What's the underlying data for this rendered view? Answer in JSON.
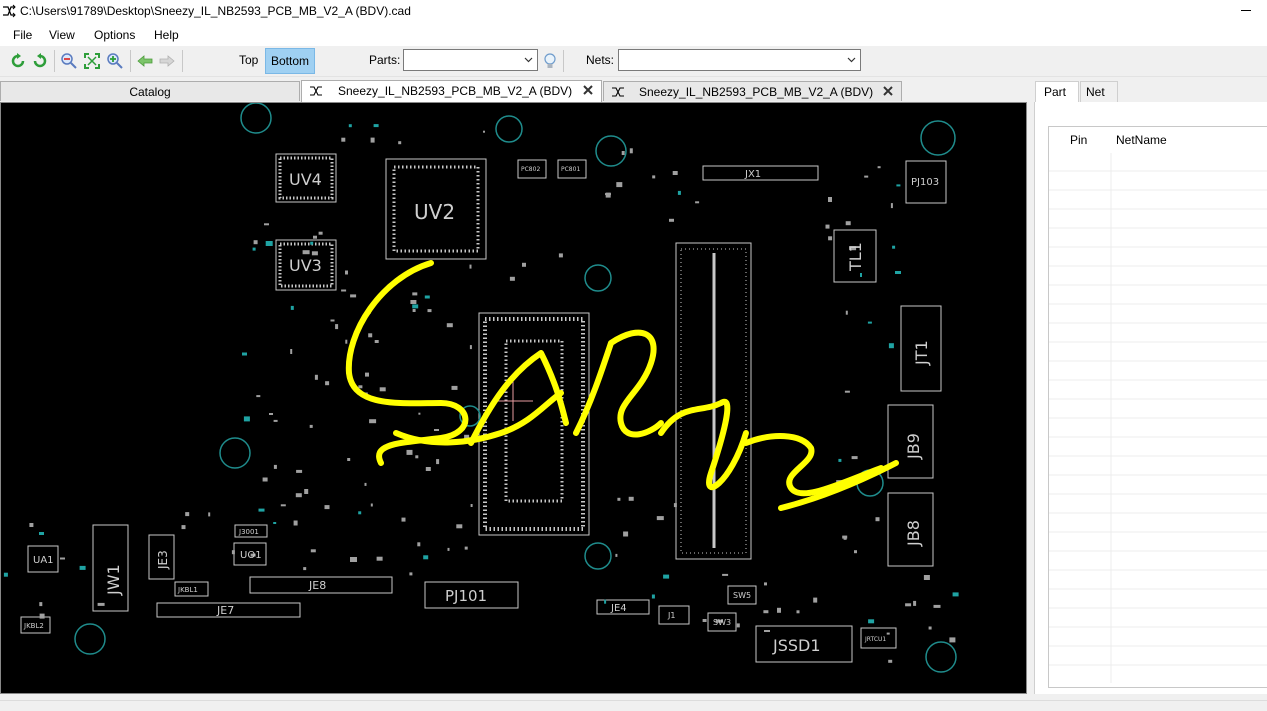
{
  "window": {
    "title": "C:\\Users\\91789\\Desktop\\Sneezy_IL_NB2593_PCB_MB_V2_A (BDV).cad"
  },
  "menu": [
    "File",
    "View",
    "Options",
    "Help"
  ],
  "toolbar": {
    "icons": [
      "refresh-green-icon",
      "refresh-green-alt-icon",
      "zoom-out-icon",
      "fit-view-icon",
      "zoom-in-icon",
      "back-arrow-icon",
      "forward-arrow-icon"
    ],
    "side_top": "Top",
    "side_bottom": "Bottom",
    "side_selected": "Bottom",
    "parts_label": "Parts:",
    "parts_value": "",
    "nets_label": "Nets:",
    "nets_value": ""
  },
  "tabs": [
    {
      "label": "Catalog"
    },
    {
      "label": "Sneezy_IL_NB2593_PCB_MB_V2_A (BDV)"
    },
    {
      "label": "Sneezy_IL_NB2593_PCB_MB_V2_A (BDV)"
    }
  ],
  "board": {
    "labels": [
      "UV4",
      "UV2",
      "UV3",
      "JX1",
      "TL1",
      "PJ103",
      "JT1",
      "JB9",
      "JB8",
      "JW1",
      "JE3",
      "UA1",
      "UO1",
      "JE8",
      "JE7",
      "PJ101",
      "JE4",
      "SW5",
      "SW3",
      "J1",
      "JSSD1",
      "JKBL1",
      "JKBL2",
      "J3001",
      "JRTCU1",
      "PC802",
      "PC801"
    ],
    "colors": {
      "background": "#000000",
      "silkscreen": "#c8c8c8",
      "annotation": "#ffff00",
      "pad": "#00bcd4"
    }
  },
  "right_panel": {
    "tabs": [
      "Part",
      "Net"
    ],
    "active_tab": "Part",
    "columns": [
      "Pin",
      "NetName"
    ]
  }
}
